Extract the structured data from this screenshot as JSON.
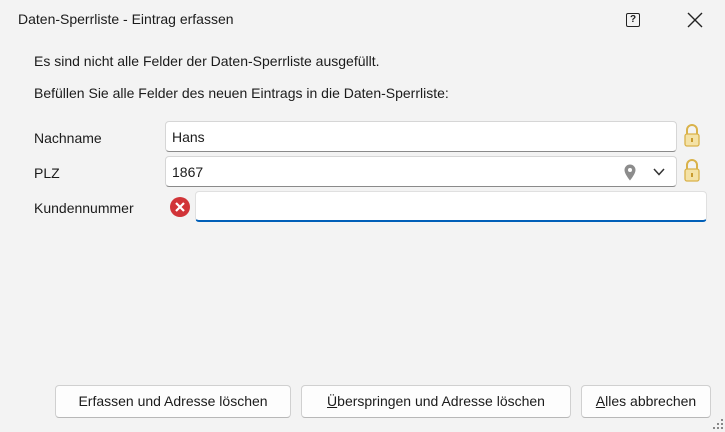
{
  "window": {
    "title": "Daten-Sperrliste - Eintrag erfassen",
    "help_label": "?"
  },
  "messages": {
    "line1": "Es sind nicht alle Felder der Daten-Sperrliste ausgefüllt.",
    "line2": "Befüllen Sie alle Felder des neuen Eintrags in die Daten-Sperrliste:"
  },
  "form": {
    "nachname": {
      "label": "Nachname",
      "value": "Hans"
    },
    "plz": {
      "label": "PLZ",
      "value": "1867"
    },
    "kundennummer": {
      "label": "Kundennummer",
      "value": "",
      "error": true
    }
  },
  "buttons": {
    "erfassen": "Erfassen und Adresse löschen",
    "ueberspringen_first": "Ü",
    "ueberspringen_rest": "berspringen und Adresse löschen",
    "abbrechen_first": "A",
    "abbrechen_rest": "lles abbrechen"
  },
  "colors": {
    "focus_underline": "#005fb8",
    "error_red": "#d13438",
    "lock_gold": "#d9b24a"
  },
  "icons": [
    "help-icon",
    "close-icon",
    "lock-icon",
    "location-pin-icon",
    "chevron-down-icon",
    "error-icon",
    "resize-grip-icon"
  ]
}
